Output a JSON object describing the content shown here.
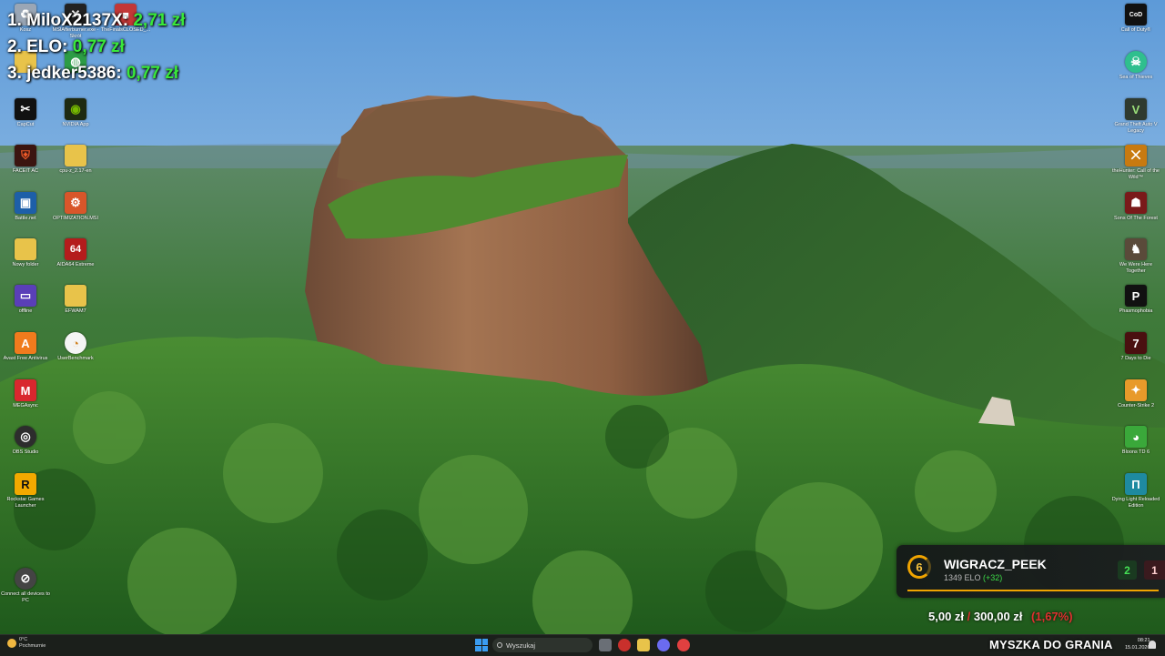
{
  "donations": [
    {
      "label": "1. MiloX2137X:",
      "amount": "2,71 zł"
    },
    {
      "label": "2. ELO:",
      "amount": "0,77 zł"
    },
    {
      "label": "3. jedker5386:",
      "amount": "0,77 zł"
    }
  ],
  "desktop_left": [
    {
      "label": "Kosz",
      "icon": "recycle-bin-icon",
      "color": "#9aa6b5"
    },
    {
      "label": "MSIAfterburner.exe - Skrót",
      "icon": "close-app-icon",
      "color": "#222222",
      "glyph": "✕"
    },
    {
      "label": "TheFinalsCLOSED_...",
      "icon": "game-icon",
      "color": "#c33737"
    },
    {
      "label": "",
      "icon": "folder-icon",
      "color": "#e8c34a"
    },
    {
      "label": "",
      "icon": "globe-icon",
      "color": "#2c9c46"
    },
    {
      "label": "CapCut",
      "icon": "capcut-icon",
      "color": "#111111",
      "glyph": "✂"
    },
    {
      "label": "NVIDIA App",
      "icon": "nvidia-icon",
      "color": "#1e2a12",
      "glyph": "◉"
    },
    {
      "label": "FACEIT AC",
      "icon": "faceit-shield-icon",
      "color": "#3b1510",
      "glyph": "⛨"
    },
    {
      "label": "cpu-z_2.17-en",
      "icon": "folder-icon",
      "color": "#e8c34a"
    },
    {
      "label": "Battle.net",
      "icon": "battlenet-icon",
      "color": "#1d5fa8",
      "glyph": "▣"
    },
    {
      "label": "OPTIMIZATION.MSI",
      "icon": "optimization-icon",
      "color": "#d8562a",
      "glyph": "⚙"
    },
    {
      "label": "Nowy folder",
      "icon": "folder-icon",
      "color": "#e8c34a"
    },
    {
      "label": "AIDA64 Extreme",
      "icon": "aida64-icon",
      "color": "#b41c1c",
      "glyph": "64"
    },
    {
      "label": "offline",
      "icon": "window-icon",
      "color": "#5a3fb8",
      "glyph": "▭"
    },
    {
      "label": "EFWAM7",
      "icon": "folder-icon",
      "color": "#e8c34a"
    },
    {
      "label": "Avast Free Antivirus",
      "icon": "avast-icon",
      "color": "#f07b1d",
      "glyph": "A"
    },
    {
      "label": "UserBenchmark",
      "icon": "gauge-icon",
      "color": "#f4f4f4",
      "glyph": "◔"
    },
    {
      "label": "MEGAsync",
      "icon": "mega-icon",
      "color": "#d9272e",
      "glyph": "M"
    },
    {
      "label": "OBS Studio",
      "icon": "obs-icon",
      "color": "#2d2d2d",
      "glyph": "◎"
    },
    {
      "label": "Rockstar Games Launcher",
      "icon": "rockstar-icon",
      "color": "#f2a900",
      "glyph": "R"
    },
    {
      "label": "Connect all devices to PC",
      "icon": "connect-icon",
      "color": "#444444",
      "glyph": "⊘"
    }
  ],
  "desktop_right": [
    {
      "label": "Call of Duty®",
      "icon": "cod-icon",
      "color": "#111111",
      "glyph": "CoD"
    },
    {
      "label": "Sea of Thieves",
      "icon": "sea-of-thieves-icon",
      "color": "#2fbf8e",
      "glyph": "☠"
    },
    {
      "label": "Grand Theft Auto V Legacy",
      "icon": "gta-icon",
      "color": "#2f3a2f",
      "glyph": "V"
    },
    {
      "label": "theHunter: Call of the Wild™",
      "icon": "hunter-icon",
      "color": "#c87a10",
      "glyph": "⨉"
    },
    {
      "label": "Sons Of The Forest",
      "icon": "sons-forest-icon",
      "color": "#7a1a1a",
      "glyph": "☗"
    },
    {
      "label": "We Were Here Together",
      "icon": "we-were-here-icon",
      "color": "#5a4a3a",
      "glyph": "♞"
    },
    {
      "label": "Phasmophobia",
      "icon": "phasmophobia-icon",
      "color": "#111111",
      "glyph": "P"
    },
    {
      "label": "7 Days to Die",
      "icon": "seven-days-icon",
      "color": "#4a1010",
      "glyph": "7"
    },
    {
      "label": "Counter-Strike 2",
      "icon": "cs2-icon",
      "color": "#e89a2a",
      "glyph": "✦"
    },
    {
      "label": "Bloons TD 6",
      "icon": "bloons-icon",
      "color": "#3aa83a",
      "glyph": "◕"
    },
    {
      "label": "Dying Light Reloaded Edition",
      "icon": "dying-light-icon",
      "color": "#1e8aa0",
      "glyph": "Π"
    }
  ],
  "match": {
    "level": "6",
    "player": "WIGRACZ_PEEK",
    "elo_text": "1349 ELO",
    "elo_delta": "(+32)",
    "wins": "2",
    "losses": "1"
  },
  "goal": {
    "current": "5,00 zł",
    "separator": "/",
    "target": "300,00 zł",
    "percent": "(1,67%)"
  },
  "taskbar": {
    "weather_temp": "0°C",
    "weather_desc": "Pochmurnie",
    "search_placeholder": "Wyszukaj",
    "brand": "MYSZKA DO GRANIA",
    "time": "08:21",
    "date": "15.01.2026"
  },
  "colors": {
    "donation_amount": "#39e83a",
    "faceit_orange": "#f0a400",
    "win_green": "#44e055",
    "goal_red": "#e03030"
  }
}
